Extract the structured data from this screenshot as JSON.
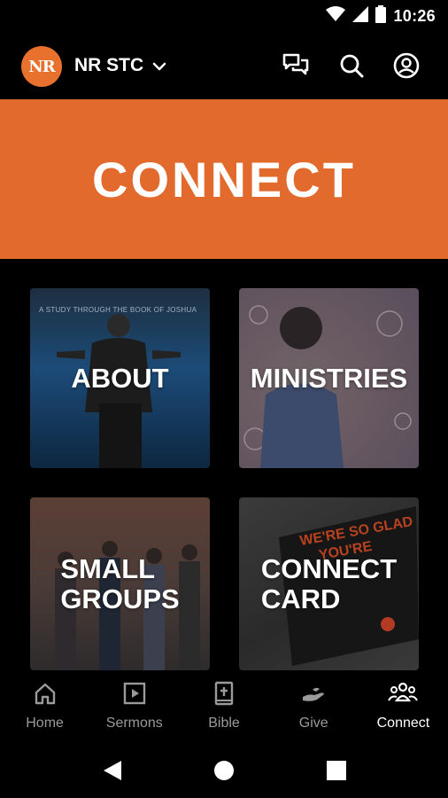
{
  "status_bar": {
    "time": "10:26"
  },
  "app_bar": {
    "logo_text": "NR",
    "campus_name": "NR STC",
    "icons": [
      "chat-icon",
      "search-icon",
      "account-icon"
    ]
  },
  "hero": {
    "title": "CONNECT"
  },
  "tiles": [
    {
      "label": "ABOUT",
      "background_text": "A STUDY THROUGH THE BOOK OF JOSHUA"
    },
    {
      "label": "MINISTRIES"
    },
    {
      "label_line1": "SMALL",
      "label_line2": "GROUPS"
    },
    {
      "label_line1": "CONNECT",
      "label_line2": "CARD",
      "background_text_1": "WE'RE SO GLAD",
      "background_text_2": "YOU'RE"
    }
  ],
  "bottom_nav": [
    {
      "label": "Home",
      "icon": "home-icon"
    },
    {
      "label": "Sermons",
      "icon": "play-icon"
    },
    {
      "label": "Bible",
      "icon": "bible-icon"
    },
    {
      "label": "Give",
      "icon": "give-icon"
    },
    {
      "label": "Connect",
      "icon": "people-icon",
      "active": true
    }
  ],
  "colors": {
    "accent": "#E36A2D",
    "background": "#000000",
    "nav_inactive": "#9A9A9A",
    "nav_active": "#FFFFFF"
  }
}
